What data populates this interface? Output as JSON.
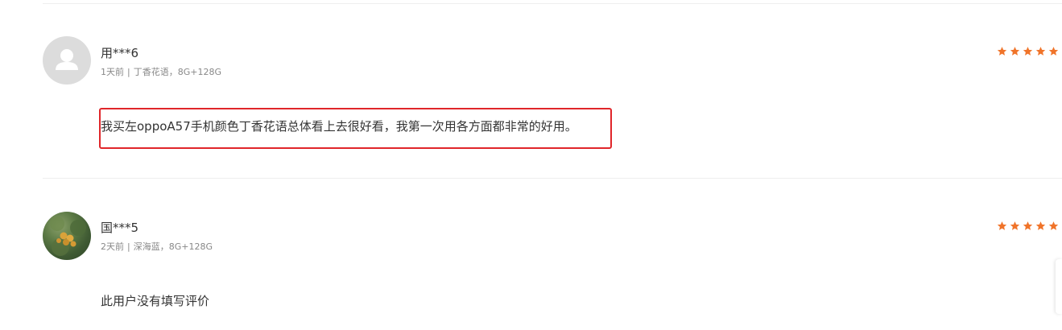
{
  "colors": {
    "star": "#f0742a",
    "highlight": "#e0262a",
    "divider": "#eeeeee"
  },
  "reviews": [
    {
      "username": "用***6",
      "time": "1天前",
      "separator": "|",
      "spec": "丁香花语，8G+128G",
      "rating": 5,
      "avatar": "default-user-icon",
      "content": "我买左oppoA57手机颜色丁香花语总体看上去很好看，我第一次用各方面都非常的好用。"
    },
    {
      "username": "国***5",
      "time": "2天前",
      "separator": "|",
      "spec": "深海蓝，8G+128G",
      "rating": 5,
      "avatar": "user-photo",
      "content": "此用户没有填写评价"
    }
  ]
}
